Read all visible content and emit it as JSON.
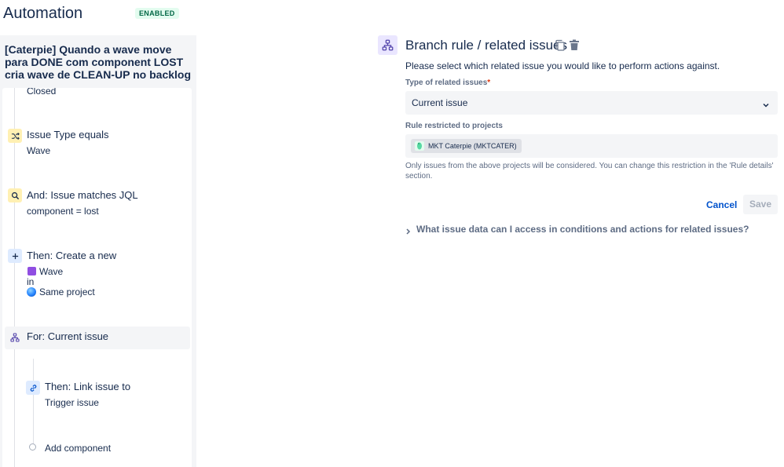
{
  "header": {
    "title": "Automation",
    "status_badge": "ENABLED"
  },
  "rule": {
    "name": "[Caterpie] Quando a wave move para DONE com component LOST cria wave de CLEAN-UP no backlog"
  },
  "components": {
    "closed_text": "Closed",
    "issue_type": {
      "title": "Issue Type equals",
      "value": "Wave"
    },
    "jql": {
      "title": "And: Issue matches JQL",
      "value": "component = lost"
    },
    "create": {
      "title": "Then: Create a new",
      "issue_type": "Wave",
      "in_text": "in",
      "project": "Same project"
    },
    "branch": {
      "title": "For: Current issue"
    },
    "link": {
      "title": "Then: Link issue to",
      "value": "Trigger issue"
    },
    "add_component": "Add component"
  },
  "panel": {
    "title": "Branch rule / related issues",
    "description": "Please select which related issue you would like to perform actions against.",
    "type_label": "Type of related issues",
    "required_mark": "*",
    "type_value": "Current issue",
    "projects_label": "Rule restricted to projects",
    "project_tag": "MKT Caterpie (MKTCATER)",
    "helper_text": "Only issues from the above projects will be considered. You can change this restriction in the 'Rule details' section.",
    "cancel_label": "Cancel",
    "save_label": "Save",
    "faq_text": "What issue data can I access in conditions and actions for related issues?"
  },
  "colors": {
    "accent": "#0052cc",
    "badge_bg": "#e3fcef",
    "badge_text": "#006644",
    "branch_icon_bg": "#eae6ff",
    "condition_icon_bg": "#fff0b3",
    "action_icon_bg": "#deebff",
    "wave_purple": "#904ee2"
  },
  "icons": {
    "condition_icon": "shuffle-icon",
    "jql_icon": "search-icon",
    "create_icon": "plus-icon",
    "branch_icon": "branch-icon",
    "link_icon": "link-icon",
    "panel_icon": "branch-icon",
    "copy": "copy-icon",
    "delete": "trash-icon",
    "select": "chevron-down-icon",
    "faq": "chevron-right-icon"
  }
}
